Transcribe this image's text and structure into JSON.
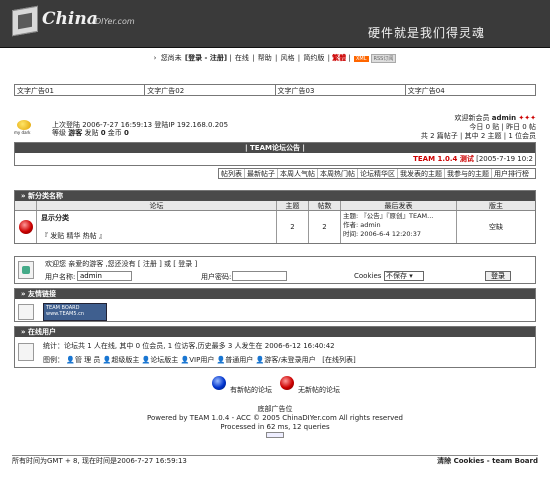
{
  "header": {
    "logo_text": "China",
    "logo_sub": "DIYer.com",
    "slogan": "硬件就是我们得灵魂"
  },
  "topnav": {
    "greeting": "您尚未",
    "login_register": "[登录 - 注册]",
    "items": [
      "在线",
      "帮助",
      "风格",
      "简约版"
    ],
    "highlight": "繁體",
    "xml": "XML",
    "xml2": "RSS订阅"
  },
  "ads": [
    "文字广告01",
    "文字广告02",
    "文字广告03",
    "文字广告04"
  ],
  "userinfo": {
    "icon_label": "my dark",
    "line1": "上次登陆 2006-7-27 16:59:13 登陆IP 192.168.0.205",
    "line2_prefix": "等级 ",
    "level": "游客",
    "line2_mid": " 发贴 ",
    "posts": "0",
    "line2_coin": " 金币 ",
    "coins": "0"
  },
  "welcome": {
    "line1_prefix": "欢迎新会员 ",
    "new_member": "admin",
    "stars": "✦✦✦",
    "line2": "今日 0 贴 | 昨日 0 帖",
    "line3": "共 2 篇帖子 | 其中 2 主题 | 1 位会员"
  },
  "announcement": {
    "title": "TEAM论坛公告",
    "text_red": "TEAM 1.0.4 测试",
    "date": "[2005-7-19 10:2"
  },
  "tools": [
    "谁家",
    "帖列表",
    "最新帖子",
    "本周人气帖",
    "本周热门帖",
    "论坛精华区",
    "我发表的主题",
    "我参与的主题",
    "用户排行榜"
  ],
  "forum": {
    "section_title": "新分类名称",
    "headers": [
      "论坛",
      "主题",
      "帖数",
      "最后发表",
      "版主"
    ],
    "rows": [
      {
        "name": "显示分类",
        "sub": "『 发贴  精华  热帖 』",
        "topics": "2",
        "posts": "2",
        "last_subject": "主题: 『公告』『原创』TEAM...",
        "last_author": "作者: admin",
        "last_time": "时间: 2006-6-4 12:20:37",
        "moderator": "空缺"
      }
    ]
  },
  "login": {
    "welcome_text": "欢迎您 亲爱的游客 ,您还没有 [ 注册 ] 或 [ 登录 ]",
    "username_label": "用户名称:",
    "username_value": "admin",
    "password_label": "用户密码:",
    "cookies_label": "Cookies :",
    "cookies_value": "不保存",
    "login_button": "登录"
  },
  "friends": {
    "title": "友情链接",
    "badge_top": "TEAM BOARD",
    "badge_bottom": "www.TEAM5.cn"
  },
  "online": {
    "title": "在线用户",
    "stats": "统计：论坛共 1 人在线, 其中 0 位会员, 1 位访客,历史最多 3 人发生在 2006-6-12 16:40:42",
    "legend_label": "图例：",
    "legend_items": [
      "管 理 员",
      "超级版主",
      "论坛版主",
      "VIP用户",
      "普通用户",
      "游客/未登录用户"
    ],
    "list_link": "[在线列表]"
  },
  "legend": {
    "new": "有新帖的论坛",
    "nonew": "无新帖的论坛"
  },
  "footer": {
    "ad": "底部广告位",
    "powered": "Powered by TEAM 1.0.4 - ACC © 2005 ChinaDIYer.com All rights reserved",
    "processed": "Processed in 62 ms, 12 queries"
  },
  "statusbar": {
    "left": "所有时间为GMT + 8, 现在时间是2006-7-27 16:59:13",
    "right_clear": "清除",
    "right_rest": " Cookies - team Board"
  },
  "colors": {
    "header_bg": "#3a3a3a",
    "section_bg": "#4a4a4a",
    "accent_red": "#cc0000"
  }
}
